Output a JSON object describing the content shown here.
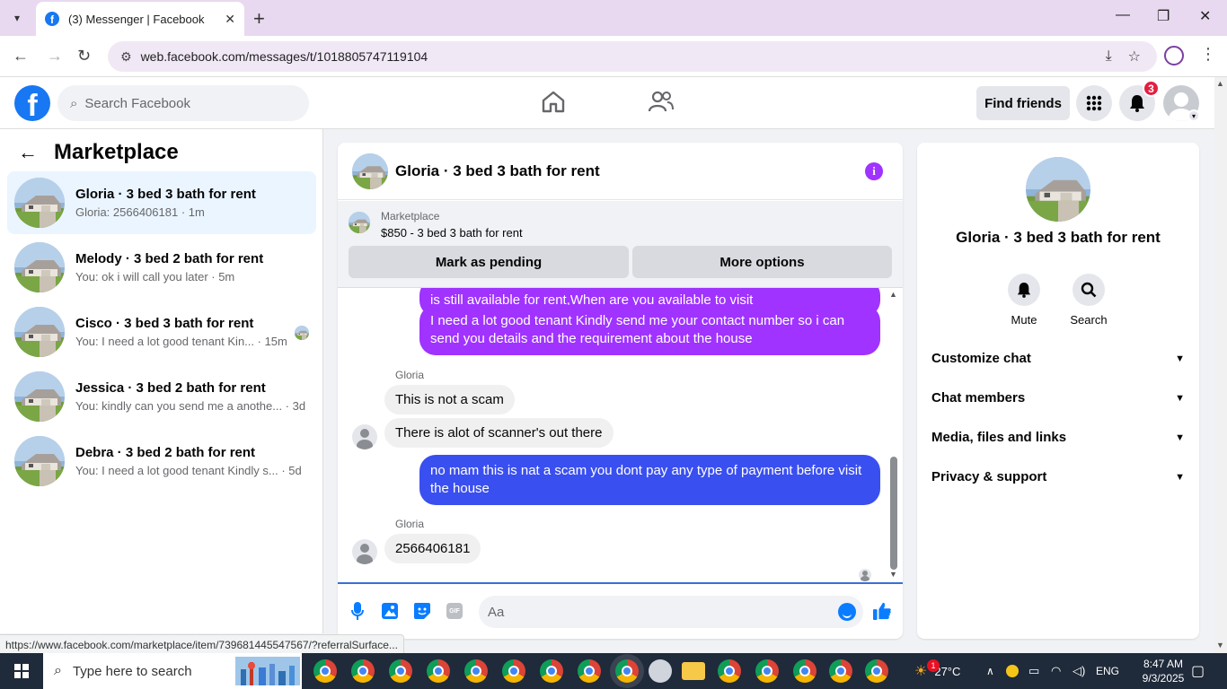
{
  "browser": {
    "tab_title": "(3) Messenger | Facebook",
    "new_tab": "+",
    "url": "web.facebook.com/messages/t/1018805747119104",
    "status_link": "https://www.facebook.com/marketplace/item/739681445547567/?referralSurface..."
  },
  "header": {
    "search_placeholder": "Search Facebook",
    "find_friends": "Find friends",
    "notification_count": "3"
  },
  "sidebar": {
    "title": "Marketplace",
    "conversations": [
      {
        "name": "Gloria · 3 bed 3 bath for rent",
        "preview": "Gloria: 2566406181 · 1m"
      },
      {
        "name": "Melody · 3 bed 2 bath for rent",
        "preview": "You: ok i will call you later · 5m"
      },
      {
        "name": "Cisco · 3 bed 3 bath for rent",
        "preview": "You: I need a lot good tenant Kin... · 15m"
      },
      {
        "name": "Jessica · 3 bed 2 bath for rent",
        "preview": "You: kindly can you send me a anothe... · 3d"
      },
      {
        "name": "Debra · 3 bed 2 bath for rent",
        "preview": "You: I need a lot good tenant Kindly s... · 5d"
      }
    ]
  },
  "chat": {
    "title": "Gloria · 3 bed 3 bath for rent",
    "listing_source": "Marketplace",
    "listing_title": "$850 - 3 bed 3 bath for rent",
    "mark_pending": "Mark as pending",
    "more_options": "More options",
    "messages": [
      {
        "text": "is still available for rent,When are you available to visit"
      },
      {
        "text": "I need a lot good tenant Kindly send me your contact number so i can send you details and the requirement about the house"
      },
      {
        "sender": "Gloria"
      },
      {
        "text": "This is not a scam"
      },
      {
        "text": "There is alot of scanner's out there"
      },
      {
        "text": "no mam this is nat a scam you dont pay any type of payment before visit the house"
      },
      {
        "sender": "Gloria"
      },
      {
        "text": "2566406181"
      }
    ],
    "composer_placeholder": "Aa",
    "gif_label": "GIF"
  },
  "right_panel": {
    "name": "Gloria · 3 bed 3 bath for rent",
    "mute": "Mute",
    "search": "Search",
    "sections": [
      "Customize chat",
      "Chat members",
      "Media, files and links",
      "Privacy & support"
    ]
  },
  "taskbar": {
    "search_placeholder": "Type here to search",
    "temperature": "27°C",
    "weather_badge": "1",
    "language": "ENG",
    "time": "8:47 AM",
    "date": "9/3/2025"
  },
  "colors": {
    "facebook_blue": "#1877f2",
    "messenger_purple": "#a033ff",
    "outgoing_blue": "#3a4ff0",
    "notification_red": "#e41e3f"
  }
}
